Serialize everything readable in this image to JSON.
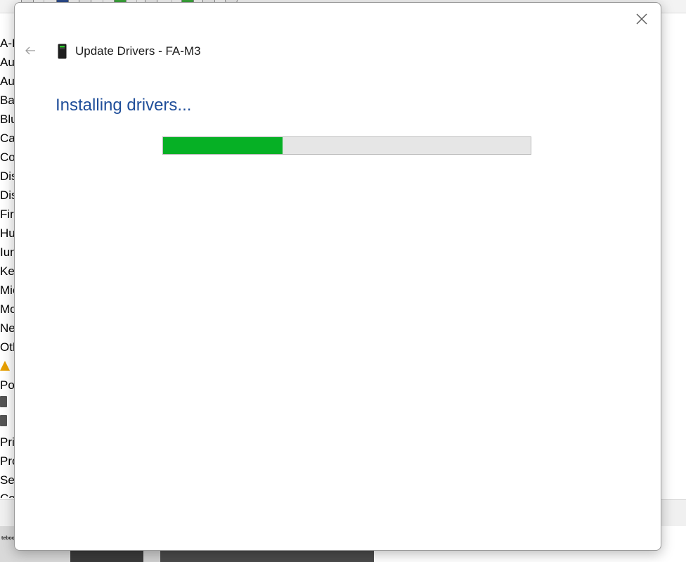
{
  "dialog": {
    "title": "Update Drivers - FA-M3",
    "status_heading": "Installing drivers...",
    "progress_fraction": 0.326,
    "accent_color": "#1f4e9a",
    "progress_color": "#06b025",
    "icons": {
      "close": "close-icon",
      "back": "back-arrow-icon",
      "device": "device-icon"
    }
  },
  "background_window": {
    "tree_items": [
      "A-B",
      "Auc",
      "Auc",
      "Batt",
      "Blu",
      "Can",
      "Cor",
      "Disk",
      "Disp",
      "Firn",
      "Hur",
      "Iun",
      "Key",
      "Mic",
      "Mo",
      "Net",
      "Oth",
      "",
      "Port",
      "",
      "",
      "Prin",
      "Proc",
      "Secu",
      "Con"
    ],
    "taskbar_thumb_label": "tebook"
  }
}
